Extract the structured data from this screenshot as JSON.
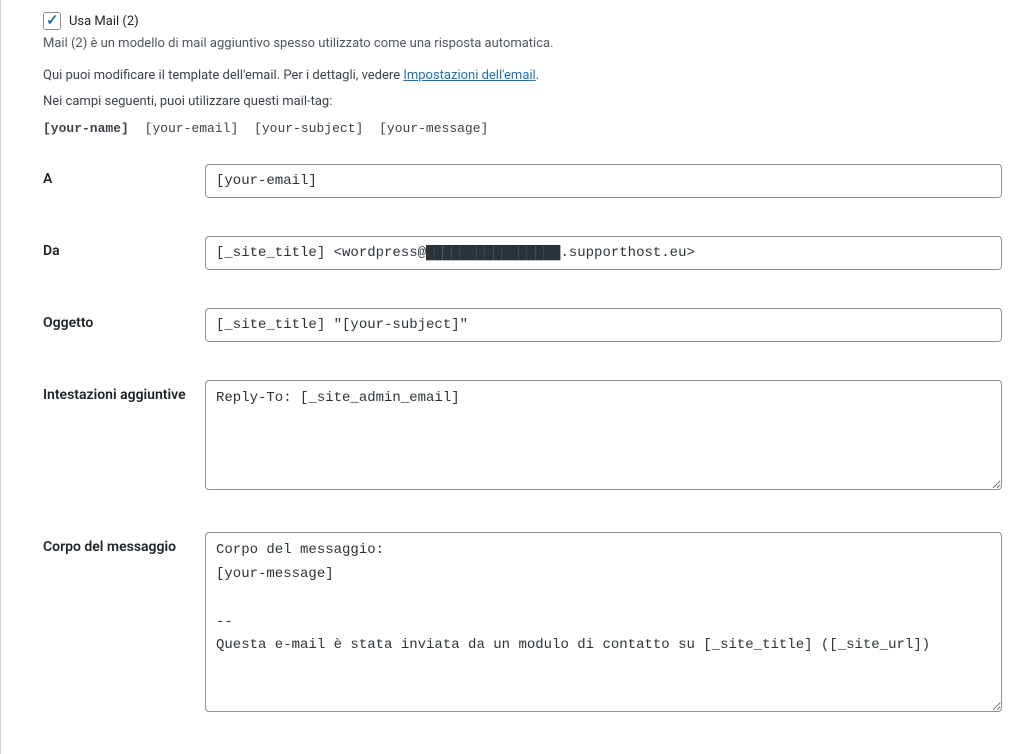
{
  "mail2": {
    "checkbox_label": "Usa Mail (2)",
    "description": "Mail (2) è un modello di mail aggiuntivo spesso utilizzato come una risposta automatica."
  },
  "instructions": {
    "line1_prefix": "Qui puoi modificare il template dell'email. Per i dettagli, vedere ",
    "link_text": "Impostazioni dell'email",
    "line1_suffix": ".",
    "line2": "Nei campi seguenti, puoi utilizzare questi mail-tag:"
  },
  "tags": {
    "name": "[your-name]",
    "email": "[your-email]",
    "subject": "[your-subject]",
    "message": "[your-message]"
  },
  "fields": {
    "to": {
      "label": "A",
      "value": "[your-email]"
    },
    "from": {
      "label": "Da",
      "value": "[_site_title] <wordpress@████████████████.supporthost.eu>"
    },
    "subject": {
      "label": "Oggetto",
      "value": "[_site_title] \"[your-subject]\""
    },
    "headers": {
      "label": "Intestazioni aggiuntive",
      "value": "Reply-To: [_site_admin_email]"
    },
    "body": {
      "label": "Corpo del messaggio",
      "value": "Corpo del messaggio:\n[your-message]\n\n-- \nQuesta e-mail è stata inviata da un modulo di contatto su [_site_title] ([_site_url])"
    }
  }
}
